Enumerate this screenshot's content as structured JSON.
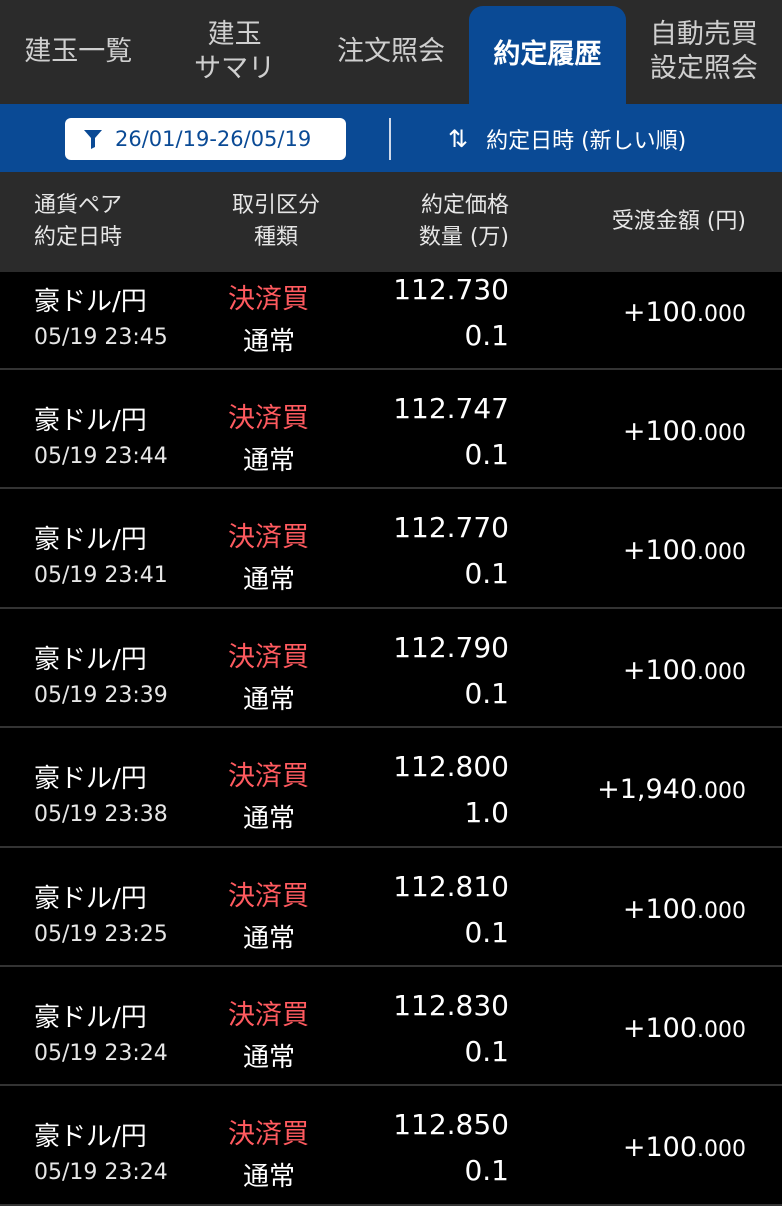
{
  "tabs": [
    {
      "label": "建玉一覧"
    },
    {
      "label": "建玉\nサマリ"
    },
    {
      "label": "注文照会"
    },
    {
      "label": "約定履歴",
      "active": true
    },
    {
      "label": "自動売買\n設定照会"
    }
  ],
  "filter": {
    "date_range": "26/01/19-26/05/19",
    "sort_label": "約定日時 (新しい順)"
  },
  "columns": {
    "col1": "通貨ペア\n約定日時",
    "col2": "取引区分\n種類",
    "col3": "約定価格\n数量 (万)",
    "col4": "受渡金額 (円)"
  },
  "colors": {
    "accent": "#0a4a95",
    "buy_close": "#ff5a5f"
  },
  "rows": [
    {
      "pair": "豪ドル/円",
      "time": "05/19 23:45",
      "kind": "決済買",
      "ordtype": "通常",
      "price": "112.730",
      "qty": "0.1",
      "amount_int": "+100",
      "amount_dec": ".000"
    },
    {
      "pair": "豪ドル/円",
      "time": "05/19 23:44",
      "kind": "決済買",
      "ordtype": "通常",
      "price": "112.747",
      "qty": "0.1",
      "amount_int": "+100",
      "amount_dec": ".000"
    },
    {
      "pair": "豪ドル/円",
      "time": "05/19 23:41",
      "kind": "決済買",
      "ordtype": "通常",
      "price": "112.770",
      "qty": "0.1",
      "amount_int": "+100",
      "amount_dec": ".000"
    },
    {
      "pair": "豪ドル/円",
      "time": "05/19 23:39",
      "kind": "決済買",
      "ordtype": "通常",
      "price": "112.790",
      "qty": "0.1",
      "amount_int": "+100",
      "amount_dec": ".000"
    },
    {
      "pair": "豪ドル/円",
      "time": "05/19 23:38",
      "kind": "決済買",
      "ordtype": "通常",
      "price": "112.800",
      "qty": "1.0",
      "amount_int": "+1,940",
      "amount_dec": ".000"
    },
    {
      "pair": "豪ドル/円",
      "time": "05/19 23:25",
      "kind": "決済買",
      "ordtype": "通常",
      "price": "112.810",
      "qty": "0.1",
      "amount_int": "+100",
      "amount_dec": ".000"
    },
    {
      "pair": "豪ドル/円",
      "time": "05/19 23:24",
      "kind": "決済買",
      "ordtype": "通常",
      "price": "112.830",
      "qty": "0.1",
      "amount_int": "+100",
      "amount_dec": ".000"
    },
    {
      "pair": "豪ドル/円",
      "time": "05/19 23:24",
      "kind": "決済買",
      "ordtype": "通常",
      "price": "112.850",
      "qty": "0.1",
      "amount_int": "+100",
      "amount_dec": ".000"
    }
  ]
}
